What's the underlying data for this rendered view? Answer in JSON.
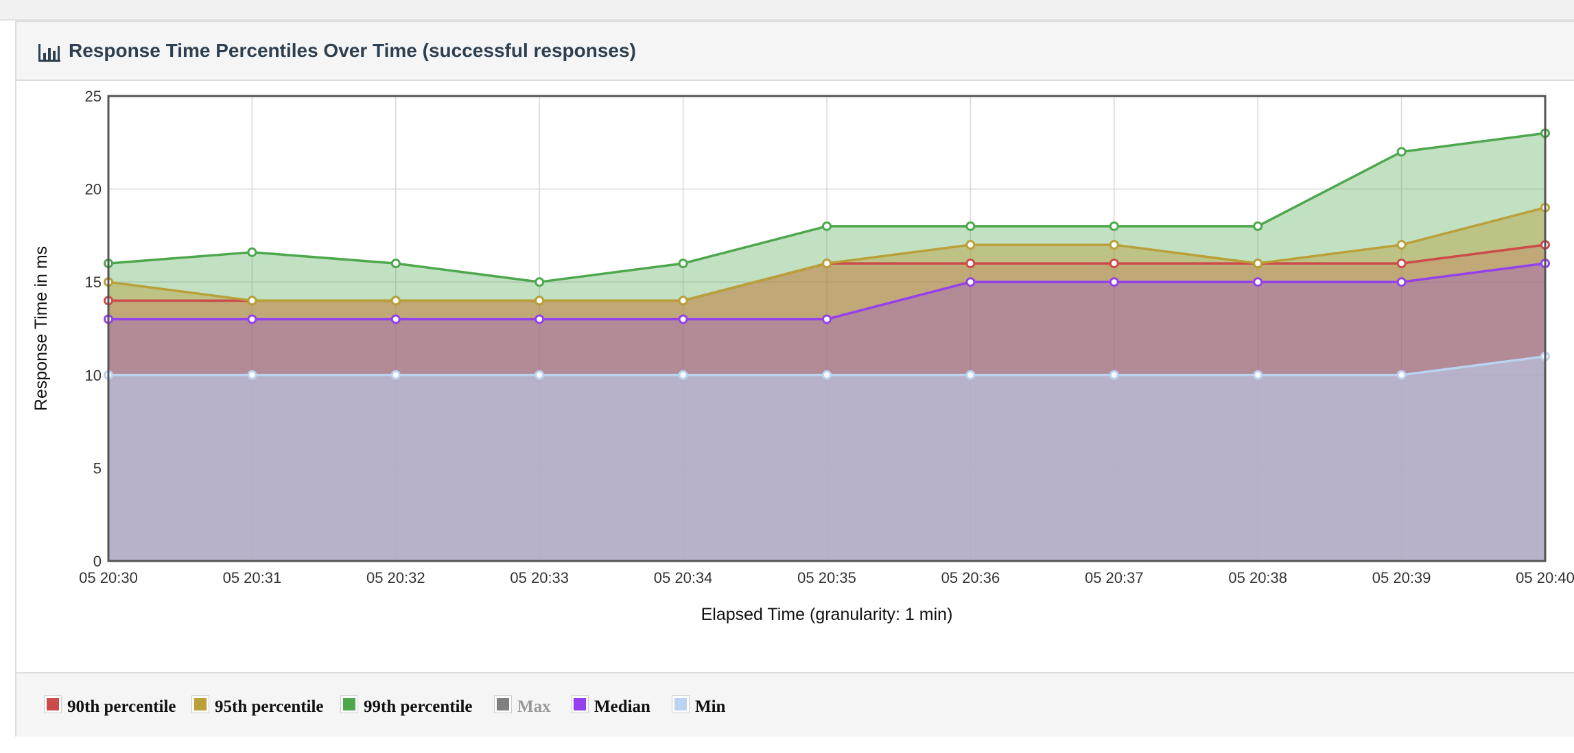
{
  "panel": {
    "title": "Response Time Percentiles Over Time (successful responses)",
    "icon": "bar-chart-icon"
  },
  "chart_data": {
    "type": "area",
    "title": "Response Time Percentiles Over Time (successful responses)",
    "xlabel": "Elapsed Time (granularity: 1 min)",
    "ylabel": "Response Time in ms",
    "categories": [
      "05 20:30",
      "05 20:31",
      "05 20:32",
      "05 20:33",
      "05 20:34",
      "05 20:35",
      "05 20:36",
      "05 20:37",
      "05 20:38",
      "05 20:39",
      "05 20:40"
    ],
    "ylim": [
      0,
      25
    ],
    "yticks": [
      0,
      5,
      10,
      15,
      20,
      25
    ],
    "grid": true,
    "legend_position": "bottom",
    "series": [
      {
        "name": "90th percentile",
        "color": "#cb4b4b",
        "values": [
          14,
          14,
          14,
          14,
          14,
          16,
          16,
          16,
          16,
          16,
          17
        ],
        "visible": true
      },
      {
        "name": "95th percentile",
        "color": "#b9a039",
        "values": [
          15,
          14,
          14,
          14,
          14,
          16,
          17,
          17,
          16,
          17,
          19
        ],
        "visible": true
      },
      {
        "name": "99th percentile",
        "color": "#4da74d",
        "values": [
          16,
          16.6,
          16,
          15,
          16,
          18,
          18,
          18,
          18,
          22,
          23
        ],
        "visible": true
      },
      {
        "name": "Max",
        "color": "#808080",
        "values": [],
        "visible": false
      },
      {
        "name": "Median",
        "color": "#9440ed",
        "values": [
          13,
          13,
          13,
          13,
          13,
          13,
          15,
          15,
          15,
          15,
          16
        ],
        "visible": true
      },
      {
        "name": "Min",
        "color": "#bad3f2",
        "values": [
          10,
          10,
          10,
          10,
          10,
          10,
          10,
          10,
          10,
          10,
          11
        ],
        "visible": true
      }
    ]
  }
}
